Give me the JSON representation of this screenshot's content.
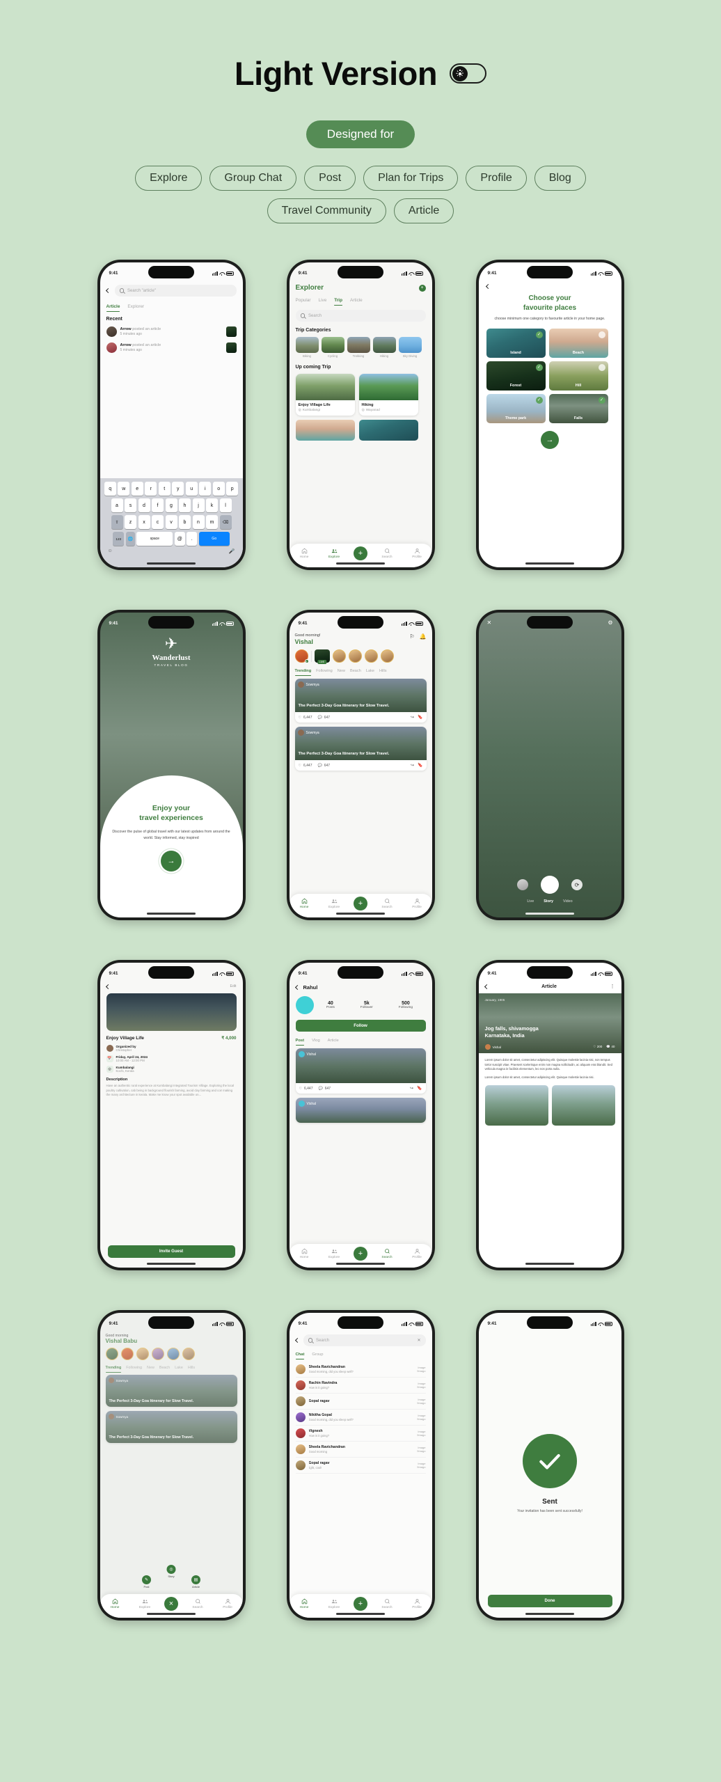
{
  "header": {
    "title": "Light Version",
    "toggle_icon": "sun-icon",
    "designed_for_label": "Designed for",
    "chips": [
      "Explore",
      "Group Chat",
      "Post",
      "Plan for Trips",
      "Profile",
      "Blog",
      "Travel Community",
      "Article"
    ]
  },
  "common": {
    "status_time": "9:41",
    "nav": [
      "Home",
      "Explore",
      "Search",
      "Profile"
    ],
    "likes": "6,447",
    "comments": "647"
  },
  "screens": {
    "search": {
      "search_placeholder": "Search \"article\"",
      "tabs": [
        "Article",
        "Explorer"
      ],
      "active_tab": "Article",
      "section": "Recent",
      "items": [
        {
          "user": "Arrow",
          "action": "posted an article",
          "time": "5 minutes ago"
        },
        {
          "user": "Arrow",
          "action": "posted an article",
          "time": "5 minutes ago"
        }
      ],
      "keyboard": {
        "row1": [
          "q",
          "w",
          "e",
          "r",
          "t",
          "y",
          "u",
          "i",
          "o",
          "p"
        ],
        "row2": [
          "a",
          "s",
          "d",
          "f",
          "g",
          "h",
          "j",
          "k",
          "l"
        ],
        "row3": [
          "z",
          "x",
          "c",
          "v",
          "b",
          "n",
          "m"
        ],
        "num_key": "123",
        "space_key": "space",
        "at_key": "@",
        "dot_key": ".",
        "go_key": "Go"
      }
    },
    "explorer": {
      "title": "Explorer",
      "tabs": [
        "Popular",
        "Live",
        "Trip",
        "Article"
      ],
      "active_tab": "Trip",
      "search_placeholder": "Search",
      "categories_title": "Trip Categories",
      "categories": [
        "Biking",
        "Cycling",
        "Trekking",
        "Hiking",
        "Sky Diving"
      ],
      "upcoming_title": "Up coming Trip",
      "trips": [
        {
          "title": "Enjoy Village Life",
          "place": "Kumbalangi"
        },
        {
          "title": "Hiking",
          "place": "Wayanad"
        }
      ]
    },
    "favourites": {
      "title_line1": "Choose your",
      "title_line2": "favourite places",
      "subtitle": "choose minimum one category to favourite article in your home page.",
      "places": [
        {
          "label": "Island",
          "selected": true
        },
        {
          "label": "Beach",
          "selected": false
        },
        {
          "label": "Forest",
          "selected": true
        },
        {
          "label": "Hill",
          "selected": false
        },
        {
          "label": "Theme park",
          "selected": true
        },
        {
          "label": "Falls",
          "selected": true
        }
      ],
      "next_icon": "arrow-right-icon"
    },
    "onboarding": {
      "brand": "Wanderlust",
      "brand_sub": "TRAVEL BLOG",
      "headline_line1": "Enjoy your",
      "headline_line2": "travel experiences",
      "body": "Discover the pulse of global travel with our latest updates from around the world. Stay informed, stay inspired",
      "cta_icon": "arrow-right-icon"
    },
    "home": {
      "greeting": "Good morning!",
      "name": "Vishal",
      "live_badge": "LIVE",
      "tabs": [
        "Trending",
        "Following",
        "New",
        "Beach",
        "Lake",
        "Hills"
      ],
      "active_tab": "Trending",
      "posts": [
        {
          "author": "Sowmya",
          "title": "The Perfect 3-Day Goa Itinerary for Slow Travel.",
          "likes": "6,447",
          "comments": "647"
        },
        {
          "author": "Sowmya",
          "title": "The Perfect 3-Day Goa Itinerary for Slow Travel.",
          "likes": "6,447",
          "comments": "647"
        }
      ]
    },
    "story": {
      "modes": [
        "Live",
        "Story",
        "Video"
      ],
      "active_mode": "Story",
      "close_icon": "close-icon",
      "flash_icon": "flash-icon",
      "settings_icon": "settings-icon",
      "flip_icon": "flip-camera-icon"
    },
    "event": {
      "edit_label": "Edit",
      "title": "Enjoy Village Life",
      "price": "₹ 4,000",
      "organizer_label": "Organized by",
      "organizer": "Christopher",
      "date": "Friday, April 24, 2024",
      "time": "10:00 AM - 12:00 PM",
      "location": "Kumbalangi",
      "location_sub": "Kochi, Kerala",
      "description_title": "Description",
      "description": "Have an authentic rural experience at Kumbalangi Integrated Tourism Village. Exploring the local poultry cultivation, cab being in background flourish farming, avoid clay farming and coir making the many architecture in kerala. Make me know your spot available on...",
      "cta": "Invite Guest"
    },
    "profile": {
      "name": "Rahul",
      "stats": [
        {
          "value": "40",
          "label": "Posts"
        },
        {
          "value": "5k",
          "label": "Follower"
        },
        {
          "value": "500",
          "label": "Following"
        }
      ],
      "follow_label": "Follow",
      "tabs": [
        "Post",
        "Vlog",
        "Article"
      ],
      "active_tab": "Post",
      "posts": [
        {
          "author": "Vishal",
          "likes": "6,447",
          "comments": "647"
        },
        {
          "author": "Vishal",
          "likes": "6,447",
          "comments": "647"
        }
      ]
    },
    "article": {
      "title": "Article",
      "date": "January, 1905",
      "headline_line1": "Jog falls, shivamogga",
      "headline_line2": "Karnataka, India",
      "author": "Vishal",
      "views": "200",
      "comments": "40",
      "body1": "Lorem ipsum dolor sit amet, consectetur adipiscing elit. Quisque molestie lacinia nisi, non tempus tortor suscipit vitae. Praesent scelerisque enim non magna sollicitudin, ac aliquam erat blandit. Sed vehicula magna in facilisis elementum, leo non porta nulla.",
      "body2": "Lorem ipsum dolor sit amet, consectetur adipiscing elit. Quisque molestie lacinia nisi.",
      "more_icon": "more-vertical-icon"
    },
    "overlay_home": {
      "greeting": "Good morning",
      "name": "Vishal Babu",
      "tabs": [
        "Trending",
        "Following",
        "New",
        "Beach",
        "Lake",
        "Hills"
      ],
      "posts": [
        {
          "author": "Sowmya",
          "title": "The Perfect 3-Day Goa Itinerary for Slow Travel."
        },
        {
          "author": "Sowmya",
          "title": "The Perfect 3-Day Goa Itinerary for Slow Travel."
        }
      ],
      "fan_options": [
        "Post",
        "Story",
        "Article"
      ]
    },
    "chat": {
      "search_placeholder": "Search",
      "tabs": [
        "Chat",
        "Group"
      ],
      "active_tab": "Chat",
      "items": [
        {
          "name": "Sheela Ravichandran",
          "msg": "Good morning, did you sleep well?",
          "meta": "9mago",
          "tag": "Image"
        },
        {
          "name": "Rachin Ravindra",
          "msg": "How is it going?",
          "meta": "9mago",
          "tag": "Image"
        },
        {
          "name": "Gopal ragav",
          "msg": "",
          "meta": "9mago",
          "tag": "Image"
        },
        {
          "name": "Nikitha Gopal",
          "msg": "Good morning, did you sleep well?",
          "meta": "9mago",
          "tag": "Image"
        },
        {
          "name": "Vignesh",
          "msg": "How is it going?",
          "meta": "9mago",
          "tag": "Image"
        },
        {
          "name": "Sheela Ravichandran",
          "msg": "Good morning",
          "meta": "9mago",
          "tag": "Image"
        },
        {
          "name": "Gopal ragav",
          "msg": "light, cool!",
          "meta": "9mago",
          "tag": "Image"
        }
      ]
    },
    "sent": {
      "check_icon": "check-icon",
      "title": "Sent",
      "message": "Your invitation has been sent successfully!",
      "cta": "Done"
    }
  },
  "colors": {
    "background": "#cce3cb",
    "primary_green": "#3a7a3c",
    "chip_border": "#5d7f5d"
  }
}
